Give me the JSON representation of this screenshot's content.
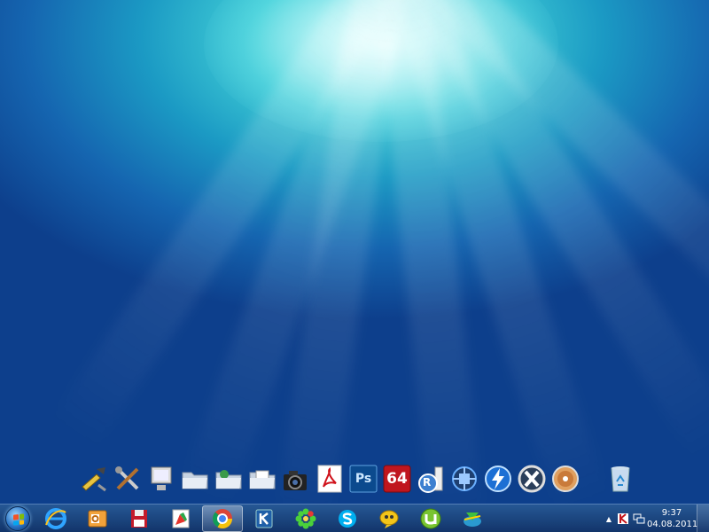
{
  "desktop": {
    "dock_items": [
      {
        "name": "system-tools-icon"
      },
      {
        "name": "tools-icon"
      },
      {
        "name": "computer-icon"
      },
      {
        "name": "folder-icon"
      },
      {
        "name": "network-folder-icon"
      },
      {
        "name": "documents-folder-icon"
      },
      {
        "name": "camera-icon"
      },
      {
        "name": "acrobat-reader-icon"
      },
      {
        "name": "photoshop-icon",
        "label": "Ps"
      },
      {
        "name": "aida64-icon",
        "label": "64"
      },
      {
        "name": "registry-icon",
        "label": "R"
      },
      {
        "name": "cpu-icon"
      },
      {
        "name": "daemon-tools-icon"
      },
      {
        "name": "x-app-icon"
      },
      {
        "name": "disc-icon"
      }
    ],
    "recycle_bin": {
      "name": "recycle-bin-icon"
    }
  },
  "taskbar": {
    "start": "start-orb-icon",
    "pinned": [
      {
        "name": "internet-explorer-icon",
        "active": false
      },
      {
        "name": "outlook-icon",
        "active": false
      },
      {
        "name": "save-disk-icon",
        "active": false
      },
      {
        "name": "paint-icon",
        "active": false
      },
      {
        "name": "chrome-icon",
        "active": true
      },
      {
        "name": "kaspersky-icon",
        "active": false
      },
      {
        "name": "icq-icon",
        "active": false
      },
      {
        "name": "skype-icon",
        "active": false
      },
      {
        "name": "qip-icon",
        "active": false
      },
      {
        "name": "utorrent-icon",
        "active": false
      },
      {
        "name": "download-manager-icon",
        "active": false
      }
    ],
    "tray": {
      "arrow": "▲",
      "icons": [
        "kaspersky-tray-icon",
        "network-tray-icon"
      ],
      "time": "9:37",
      "date": "04.08.2011"
    }
  },
  "colors": {
    "accent": "#1b9ac4",
    "taskbar": "#1a3f78"
  }
}
